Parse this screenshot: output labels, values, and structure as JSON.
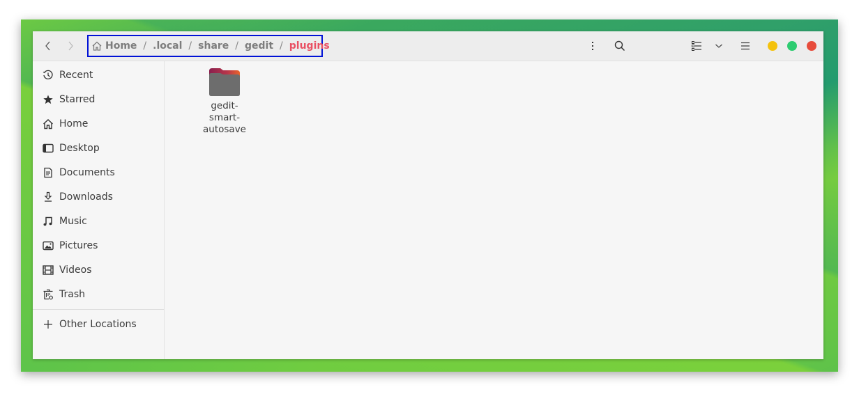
{
  "headerbar": {
    "back_icon": "chevron-left-icon",
    "forward_icon": "chevron-right-icon",
    "breadcrumb": {
      "home_icon": "home-icon",
      "segments": [
        "Home",
        ".local",
        "share",
        "gedit",
        "plugins"
      ],
      "separator": "/",
      "active_index": 4
    },
    "actions": {
      "menu_icon": "vertical-ellipsis-icon",
      "search_icon": "search-icon",
      "view_icon": "list-view-icon",
      "view_options_icon": "chevron-down-icon",
      "main_menu_icon": "hamburger-menu-icon"
    },
    "window_controls": {
      "minimize_color": "#f4c20d",
      "maximize_color": "#2ecc71",
      "close_color": "#e74c3c"
    }
  },
  "sidebar": {
    "items": [
      {
        "label": "Recent",
        "icon": "clock-icon"
      },
      {
        "label": "Starred",
        "icon": "star-icon"
      },
      {
        "label": "Home",
        "icon": "home-icon"
      },
      {
        "label": "Desktop",
        "icon": "desktop-icon"
      },
      {
        "label": "Documents",
        "icon": "document-icon"
      },
      {
        "label": "Downloads",
        "icon": "download-icon"
      },
      {
        "label": "Music",
        "icon": "music-icon"
      },
      {
        "label": "Pictures",
        "icon": "picture-icon"
      },
      {
        "label": "Videos",
        "icon": "film-icon"
      },
      {
        "label": "Trash",
        "icon": "trash-icon"
      }
    ],
    "other_locations": {
      "label": "Other Locations",
      "icon": "plus-icon"
    }
  },
  "content": {
    "files": [
      {
        "name": "gedit-smart-autosave",
        "display_name": "gedit-\nsmart-\nautosave",
        "type": "folder"
      }
    ]
  },
  "colors": {
    "accent": "#e95063",
    "highlight_box": "#0012d6"
  }
}
